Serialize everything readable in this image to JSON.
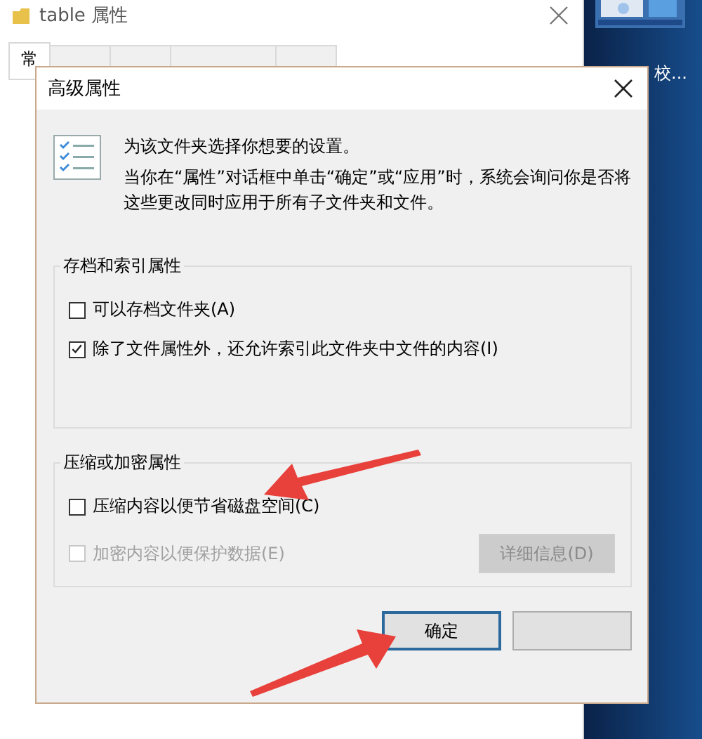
{
  "parent_window": {
    "title": "table 属性",
    "tabs": [
      {
        "label": "常",
        "selected": true
      },
      {
        "selected": false
      },
      {
        "selected": false
      },
      {
        "selected": false
      },
      {
        "selected": false
      }
    ]
  },
  "desktop": {
    "icon_labels": [
      "校..."
    ]
  },
  "dialog": {
    "title": "高级属性",
    "intro": "为该文件夹选择你想要的设置。",
    "description": "当你在“属性”对话框中单击“确定”或“应用”时，系统会询问你是否将这些更改同时应用于所有子文件夹和文件。",
    "groups": [
      {
        "title": "存档和索引属性",
        "options": [
          {
            "label": "可以存档文件夹(A)",
            "checked": false,
            "disabled": false
          },
          {
            "label": "除了文件属性外，还允许索引此文件夹中文件的内容(I)",
            "checked": true,
            "disabled": false
          }
        ]
      },
      {
        "title": "压缩或加密属性",
        "options": [
          {
            "label": "压缩内容以便节省磁盘空间(C)",
            "checked": false,
            "disabled": false
          },
          {
            "label": "加密内容以便保护数据(E)",
            "checked": false,
            "disabled": true
          }
        ],
        "button": {
          "label": "详细信息(D)",
          "disabled": true
        }
      }
    ],
    "buttons": [
      {
        "label": "确定",
        "default": true
      },
      {
        "default": false
      }
    ]
  }
}
